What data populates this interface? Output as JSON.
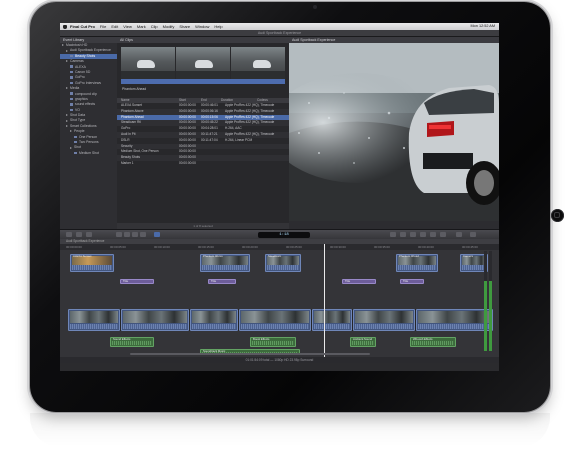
{
  "menubar": {
    "items": [
      "Final Cut Pro",
      "File",
      "Edit",
      "View",
      "Mark",
      "Clip",
      "Modify",
      "Share",
      "Window",
      "Help"
    ],
    "clock": "Mon 12:52 AM"
  },
  "window": {
    "title": "Audi Sportback Experience"
  },
  "library": {
    "header": "Event Library",
    "items": [
      {
        "label": "Macintosh HD",
        "indent": 0,
        "tri": true,
        "sel": false
      },
      {
        "label": "Audi Sportback Experience",
        "indent": 1,
        "tri": true,
        "sel": false
      },
      {
        "label": "Beauty Shots",
        "indent": 2,
        "tri": false,
        "sel": true
      },
      {
        "label": "Cameras",
        "indent": 1,
        "tri": true,
        "sel": false
      },
      {
        "label": "ALEXA",
        "indent": 2,
        "tri": false,
        "sel": false
      },
      {
        "label": "Canon 5D",
        "indent": 2,
        "tri": false,
        "sel": false
      },
      {
        "label": "GoPro",
        "indent": 2,
        "tri": false,
        "sel": false
      },
      {
        "label": "GoPro Interviews",
        "indent": 2,
        "tri": false,
        "sel": false
      },
      {
        "label": "Media",
        "indent": 1,
        "tri": true,
        "sel": false
      },
      {
        "label": "compound clip",
        "indent": 2,
        "tri": false,
        "sel": false
      },
      {
        "label": "graphics",
        "indent": 2,
        "tri": false,
        "sel": false
      },
      {
        "label": "sound effects",
        "indent": 2,
        "tri": false,
        "sel": false
      },
      {
        "label": "VO",
        "indent": 2,
        "tri": false,
        "sel": false
      },
      {
        "label": "Shot Data",
        "indent": 1,
        "tri": true,
        "sel": false
      },
      {
        "label": "Shot Type",
        "indent": 1,
        "tri": true,
        "sel": false
      },
      {
        "label": "Smart Collections",
        "indent": 1,
        "tri": true,
        "sel": false
      },
      {
        "label": "People",
        "indent": 2,
        "tri": true,
        "sel": false
      },
      {
        "label": "One Person",
        "indent": 3,
        "tri": false,
        "sel": false
      },
      {
        "label": "Two Persons",
        "indent": 3,
        "tri": false,
        "sel": false
      },
      {
        "label": "Shot",
        "indent": 2,
        "tri": true,
        "sel": false
      },
      {
        "label": "Medium Shot",
        "indent": 3,
        "tri": false,
        "sel": false
      }
    ]
  },
  "browser": {
    "filter": "All Clips",
    "filmstrip_name": "Phantom Ahead",
    "columns": [
      "Name",
      "Start",
      "End",
      "Duration",
      "Codecs"
    ],
    "rows": [
      {
        "name": "ALEXA Sunset",
        "start": "00:00:00:00",
        "end": "00:00:46:01",
        "codec": "Apple ProRes 422 (HQ), Timecode",
        "sel": false
      },
      {
        "name": "Phantom Above",
        "start": "00:00:00:00",
        "end": "00:00:06:16",
        "codec": "Apple ProRes 422 (HQ), Timecode",
        "sel": false
      },
      {
        "name": "Phantom Ahead",
        "start": "00:00:00:00",
        "end": "00:00:15:06",
        "codec": "Apple ProRes 422 (HQ), Timecode",
        "sel": true
      },
      {
        "name": "Steadicam Rtl",
        "start": "00:00:00:00",
        "end": "00:00:45:22",
        "codec": "Apple ProRes 422 (HQ), Timecode",
        "sel": false
      },
      {
        "name": "GoPro",
        "start": "00:00:00:00",
        "end": "00:04:28:01",
        "codec": "H.264, AAC",
        "sel": false
      },
      {
        "name": "Audi In Pit",
        "start": "00:00:00:00",
        "end": "00:11:47:21",
        "codec": "Apple ProRes 422 (HQ), Timecode",
        "sel": false
      },
      {
        "name": "DSLR",
        "start": "00:00:00:00",
        "end": "00:11:47:04",
        "codec": "H.264, Linear PCM",
        "sel": false
      },
      {
        "name": "Security",
        "start": "00:00:00:00",
        "end": "",
        "codec": "",
        "sel": false
      },
      {
        "name": "Medium Shot, One Person",
        "start": "00:00:00:00",
        "end": "",
        "codec": "",
        "sel": false
      },
      {
        "name": "Beauty Shots",
        "start": "00:00:00:00",
        "end": "",
        "codec": "",
        "sel": false
      },
      {
        "name": "Marker 1",
        "start": "00:00:00:00",
        "end": "",
        "codec": "",
        "sel": false
      }
    ],
    "footer": "1 of 8 selected"
  },
  "viewer": {
    "header": "Audi Sportback Experience"
  },
  "toolbar": {
    "timecode": "1:18"
  },
  "timeline": {
    "header": "Audi Sportback Experience",
    "ruler": [
      "00:00:00:00",
      "00:00:05:00",
      "00:00:10:00",
      "00:00:15:00",
      "00:00:20:00",
      "00:00:25:00",
      "00:00:30:00",
      "00:00:35:00",
      "00:00:40:00",
      "00:00:45:00"
    ],
    "footer": "01:01:54:09 total — 1080p HD 23.98p Surround",
    "clips": {
      "top": [
        "ALEXA Sunset",
        "Phantom Above",
        "Steadicam",
        "Phantom Ahead",
        "Camera"
      ],
      "titles": [
        "Title",
        "Title",
        "Title",
        "Title"
      ],
      "audio": [
        "Sound Effects",
        "Boost Effects",
        "Ambient Sound",
        "Whoosh Effects"
      ],
      "music": "Soundtrack Music"
    }
  },
  "colors": {
    "accent_selection": "#4a6aa8",
    "video_clip": "#42557e",
    "audio_clip": "#3c6b3c",
    "title_clip": "#6d5d9a"
  }
}
